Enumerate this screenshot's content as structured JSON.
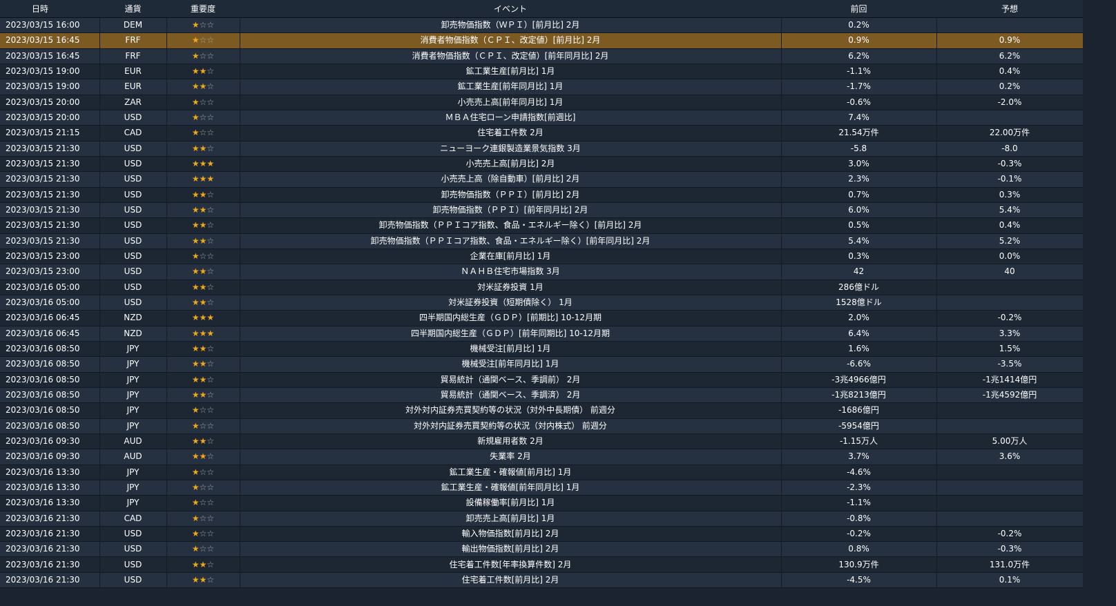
{
  "headers": {
    "date": "日時",
    "currency": "通貨",
    "importance": "重要度",
    "event": "イベント",
    "previous": "前回",
    "forecast": "予想"
  },
  "colors": {
    "star_on": "#f0a818",
    "star_off": "#a8a8a8",
    "highlight_row": "#7c5a22"
  },
  "rows": [
    {
      "date": "2023/03/15 16:00",
      "currency": "DEM",
      "stars": 1,
      "event": "卸売物価指数（ＷＰＩ）[前月比] 2月",
      "previous": "0.2%",
      "forecast": "",
      "highlight": false
    },
    {
      "date": "2023/03/15 16:45",
      "currency": "FRF",
      "stars": 1,
      "event": "消費者物価指数（ＣＰＩ、改定値）[前月比] 2月",
      "previous": "0.9%",
      "forecast": "0.9%",
      "highlight": true
    },
    {
      "date": "2023/03/15 16:45",
      "currency": "FRF",
      "stars": 1,
      "event": "消費者物価指数（ＣＰＩ、改定値）[前年同月比] 2月",
      "previous": "6.2%",
      "forecast": "6.2%",
      "highlight": false
    },
    {
      "date": "2023/03/15 19:00",
      "currency": "EUR",
      "stars": 2,
      "event": "鉱工業生産[前月比] 1月",
      "previous": "-1.1%",
      "forecast": "0.4%",
      "highlight": false
    },
    {
      "date": "2023/03/15 19:00",
      "currency": "EUR",
      "stars": 2,
      "event": "鉱工業生産[前年同月比] 1月",
      "previous": "-1.7%",
      "forecast": "0.2%",
      "highlight": false
    },
    {
      "date": "2023/03/15 20:00",
      "currency": "ZAR",
      "stars": 1,
      "event": "小売売上高[前年同月比] 1月",
      "previous": "-0.6%",
      "forecast": "-2.0%",
      "highlight": false
    },
    {
      "date": "2023/03/15 20:00",
      "currency": "USD",
      "stars": 1,
      "event": "ＭＢＡ住宅ローン申請指数[前週比]",
      "previous": "7.4%",
      "forecast": "",
      "highlight": false
    },
    {
      "date": "2023/03/15 21:15",
      "currency": "CAD",
      "stars": 1,
      "event": "住宅着工件数 2月",
      "previous": "21.54万件",
      "forecast": "22.00万件",
      "highlight": false
    },
    {
      "date": "2023/03/15 21:30",
      "currency": "USD",
      "stars": 2,
      "event": "ニューヨーク連銀製造業景気指数 3月",
      "previous": "-5.8",
      "forecast": "-8.0",
      "highlight": false
    },
    {
      "date": "2023/03/15 21:30",
      "currency": "USD",
      "stars": 3,
      "event": "小売売上高[前月比] 2月",
      "previous": "3.0%",
      "forecast": "-0.3%",
      "highlight": false
    },
    {
      "date": "2023/03/15 21:30",
      "currency": "USD",
      "stars": 3,
      "event": "小売売上高（除自動車）[前月比] 2月",
      "previous": "2.3%",
      "forecast": "-0.1%",
      "highlight": false
    },
    {
      "date": "2023/03/15 21:30",
      "currency": "USD",
      "stars": 2,
      "event": "卸売物価指数（ＰＰＩ）[前月比] 2月",
      "previous": "0.7%",
      "forecast": "0.3%",
      "highlight": false
    },
    {
      "date": "2023/03/15 21:30",
      "currency": "USD",
      "stars": 2,
      "event": "卸売物価指数（ＰＰＩ）[前年同月比] 2月",
      "previous": "6.0%",
      "forecast": "5.4%",
      "highlight": false
    },
    {
      "date": "2023/03/15 21:30",
      "currency": "USD",
      "stars": 2,
      "event": "卸売物価指数（ＰＰＩコア指数、食品・エネルギー除く）[前月比] 2月",
      "previous": "0.5%",
      "forecast": "0.4%",
      "highlight": false
    },
    {
      "date": "2023/03/15 21:30",
      "currency": "USD",
      "stars": 2,
      "event": "卸売物価指数（ＰＰＩコア指数、食品・エネルギー除く）[前年同月比] 2月",
      "previous": "5.4%",
      "forecast": "5.2%",
      "highlight": false
    },
    {
      "date": "2023/03/15 23:00",
      "currency": "USD",
      "stars": 1,
      "event": "企業在庫[前月比] 1月",
      "previous": "0.3%",
      "forecast": "0.0%",
      "highlight": false
    },
    {
      "date": "2023/03/15 23:00",
      "currency": "USD",
      "stars": 2,
      "event": "ＮＡＨＢ住宅市場指数 3月",
      "previous": "42",
      "forecast": "40",
      "highlight": false
    },
    {
      "date": "2023/03/16 05:00",
      "currency": "USD",
      "stars": 2,
      "event": "対米証券投資 1月",
      "previous": "286億ドル",
      "forecast": "",
      "highlight": false
    },
    {
      "date": "2023/03/16 05:00",
      "currency": "USD",
      "stars": 2,
      "event": "対米証券投資（短期債除く） 1月",
      "previous": "1528億ドル",
      "forecast": "",
      "highlight": false
    },
    {
      "date": "2023/03/16 06:45",
      "currency": "NZD",
      "stars": 3,
      "event": "四半期国内総生産（ＧＤＰ）[前期比] 10-12月期",
      "previous": "2.0%",
      "forecast": "-0.2%",
      "highlight": false
    },
    {
      "date": "2023/03/16 06:45",
      "currency": "NZD",
      "stars": 3,
      "event": "四半期国内総生産（ＧＤＰ）[前年同期比] 10-12月期",
      "previous": "6.4%",
      "forecast": "3.3%",
      "highlight": false
    },
    {
      "date": "2023/03/16 08:50",
      "currency": "JPY",
      "stars": 2,
      "event": "機械受注[前月比] 1月",
      "previous": "1.6%",
      "forecast": "1.5%",
      "highlight": false
    },
    {
      "date": "2023/03/16 08:50",
      "currency": "JPY",
      "stars": 2,
      "event": "機械受注[前年同月比] 1月",
      "previous": "-6.6%",
      "forecast": "-3.5%",
      "highlight": false
    },
    {
      "date": "2023/03/16 08:50",
      "currency": "JPY",
      "stars": 2,
      "event": "貿易統計（通関ベース、季調前） 2月",
      "previous": "-3兆4966億円",
      "forecast": "-1兆1414億円",
      "highlight": false
    },
    {
      "date": "2023/03/16 08:50",
      "currency": "JPY",
      "stars": 2,
      "event": "貿易統計（通関ベース、季調済） 2月",
      "previous": "-1兆8213億円",
      "forecast": "-1兆4592億円",
      "highlight": false
    },
    {
      "date": "2023/03/16 08:50",
      "currency": "JPY",
      "stars": 1,
      "event": "対外対内証券売買契約等の状況（対外中長期債） 前週分",
      "previous": "-1686億円",
      "forecast": "",
      "highlight": false
    },
    {
      "date": "2023/03/16 08:50",
      "currency": "JPY",
      "stars": 1,
      "event": "対外対内証券売買契約等の状況（対内株式） 前週分",
      "previous": "-5954億円",
      "forecast": "",
      "highlight": false
    },
    {
      "date": "2023/03/16 09:30",
      "currency": "AUD",
      "stars": 2,
      "event": "新規雇用者数 2月",
      "previous": "-1.15万人",
      "forecast": "5.00万人",
      "highlight": false
    },
    {
      "date": "2023/03/16 09:30",
      "currency": "AUD",
      "stars": 2,
      "event": "失業率 2月",
      "previous": "3.7%",
      "forecast": "3.6%",
      "highlight": false
    },
    {
      "date": "2023/03/16 13:30",
      "currency": "JPY",
      "stars": 1,
      "event": "鉱工業生産・確報値[前月比] 1月",
      "previous": "-4.6%",
      "forecast": "",
      "highlight": false
    },
    {
      "date": "2023/03/16 13:30",
      "currency": "JPY",
      "stars": 1,
      "event": "鉱工業生産・確報値[前年同月比] 1月",
      "previous": "-2.3%",
      "forecast": "",
      "highlight": false
    },
    {
      "date": "2023/03/16 13:30",
      "currency": "JPY",
      "stars": 1,
      "event": "設備稼働率[前月比] 1月",
      "previous": "-1.1%",
      "forecast": "",
      "highlight": false
    },
    {
      "date": "2023/03/16 21:30",
      "currency": "CAD",
      "stars": 1,
      "event": "卸売売上高[前月比] 1月",
      "previous": "-0.8%",
      "forecast": "",
      "highlight": false
    },
    {
      "date": "2023/03/16 21:30",
      "currency": "USD",
      "stars": 1,
      "event": "輸入物価指数[前月比] 2月",
      "previous": "-0.2%",
      "forecast": "-0.2%",
      "highlight": false
    },
    {
      "date": "2023/03/16 21:30",
      "currency": "USD",
      "stars": 1,
      "event": "輸出物価指数[前月比] 2月",
      "previous": "0.8%",
      "forecast": "-0.3%",
      "highlight": false
    },
    {
      "date": "2023/03/16 21:30",
      "currency": "USD",
      "stars": 2,
      "event": "住宅着工件数[年率換算件数] 2月",
      "previous": "130.9万件",
      "forecast": "131.0万件",
      "highlight": false
    },
    {
      "date": "2023/03/16 21:30",
      "currency": "USD",
      "stars": 2,
      "event": "住宅着工件数[前月比] 2月",
      "previous": "-4.5%",
      "forecast": "0.1%",
      "highlight": false
    }
  ]
}
